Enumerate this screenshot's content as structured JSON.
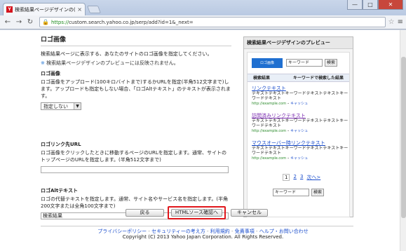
{
  "browser": {
    "tab_title": "検索結果ページデザインの(新規",
    "tab_close": "×",
    "url_scheme": "https://",
    "url_rest": "custom.search.yahoo.co.jp/serp/add?id=1&_next=",
    "win_min": "—",
    "win_max": "□",
    "win_close": "✕"
  },
  "main": {
    "section_title": "ロゴ画像",
    "intro": "検索結果ページに表示する、あなたのサイトのロゴ画像を指定してください。",
    "note_mark": "※",
    "note": "検索結果ページデザインのプレビューには反映されません。",
    "logo_heading": "ロゴ画像",
    "logo_desc": "ロゴ画像をアップロード(100キロバイトまで)するかURLを指定(半角512文字まで)します。アップロードも指定もしない場合、「ロゴAltテキスト」のテキストが表示されます。",
    "logo_select_value": "指定しない",
    "link_heading": "ロゴリンク先URL",
    "link_desc": "ロゴ画像をクリックしたときに移動するページのURLを指定します。通常、サイトのトップページのURLを指定します。(半角512文字まで)",
    "link_value": "",
    "alt_heading": "ロゴAltテキスト",
    "alt_desc": "ロゴの代替テキストを指定します。通常、サイト名やサービス名を指定します。(半角200文字または全角100文字まで)",
    "alt_value": "検索結果"
  },
  "preview": {
    "title": "検索結果ページデザインのプレビュー",
    "logo_text": "ロゴ画像",
    "search_value": "キーワード",
    "search_button": "検索",
    "bar_left": "検索結果",
    "bar_right": "キーワードで検索した結果",
    "results": [
      {
        "link": "リンクテキスト",
        "desc": "テキストテキストキーワードテキストテキストキーワードテキスト",
        "url": "http://example.com",
        "cache": "キャッシュ"
      },
      {
        "link": "訪問済みリンクテキスト",
        "desc": "テキストテキストキーワードテキストテキストキーワードテキスト",
        "url": "http://example.com",
        "cache": "キャッシュ"
      },
      {
        "link": "マウスオーバー時リンクテキスト",
        "desc": "テキストテキストキーワードテキストテキストキーワードテキスト",
        "url": "http://example.com",
        "cache": "キャッシュ"
      }
    ],
    "pager": [
      "1",
      "2",
      "3",
      "次へ>"
    ],
    "bottom_search_value": "キーワード",
    "bottom_search_button": "検索"
  },
  "buttons": {
    "back": "戻る",
    "html": "HTMLソース確認へ",
    "cancel": "キャンセル"
  },
  "footer": {
    "links": [
      "プライバシーポリシー",
      "セキュリティーの考え方",
      "利用規約",
      "免責事項",
      "ヘルプ・お問い合わせ"
    ],
    "copyright": "Copyright (C) 2013 Yahoo Japan Corporation. All Rights Reserved."
  }
}
